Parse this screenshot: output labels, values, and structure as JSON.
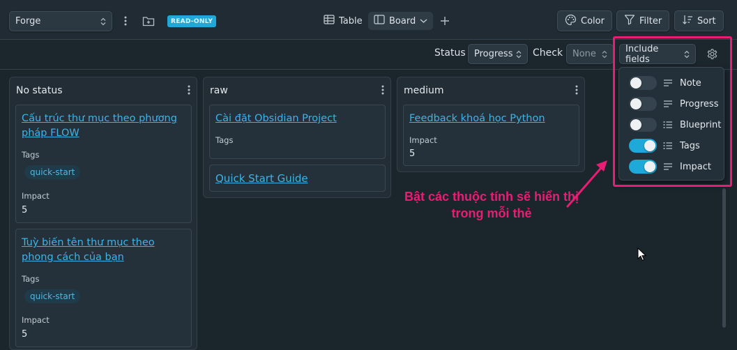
{
  "project": {
    "selected": "Forge",
    "readonly_badge": "READ-ONLY"
  },
  "views": {
    "table_label": "Table",
    "board_label": "Board"
  },
  "toolbar": {
    "color_label": "Color",
    "filter_label": "Filter",
    "sort_label": "Sort"
  },
  "subbar": {
    "status_label": "Status",
    "status_value": "Progress",
    "check_label": "Check",
    "check_value": "None",
    "include_fields_label": "Include fields"
  },
  "columns": [
    {
      "title": "No status",
      "cards": [
        {
          "title": "Cấu trúc thư mục theo phương pháp FLOW",
          "tags_label": "Tags",
          "tag": "quick-start",
          "impact_label": "Impact",
          "impact_value": "5"
        },
        {
          "title": "Tuỳ biến tên thư mục theo phong cách của bạn",
          "tags_label": "Tags",
          "tag": "quick-start",
          "impact_label": "Impact",
          "impact_value": "5"
        }
      ]
    },
    {
      "title": "raw",
      "cards": [
        {
          "title": "Cài đặt Obsidian Project",
          "tags_label": "Tags"
        },
        {
          "title": "Quick Start Guide"
        }
      ]
    },
    {
      "title": "medium",
      "cards": [
        {
          "title": "Feedback khoá học Python",
          "impact_label": "Impact",
          "impact_value": "5"
        }
      ]
    }
  ],
  "fields_popover": {
    "items": [
      {
        "label": "Note",
        "enabled": false,
        "icon": "text-lines-icon"
      },
      {
        "label": "Progress",
        "enabled": false,
        "icon": "text-lines-icon"
      },
      {
        "label": "Blueprint",
        "enabled": false,
        "icon": "list-icon"
      },
      {
        "label": "Tags",
        "enabled": true,
        "icon": "list-icon"
      },
      {
        "label": "Impact",
        "enabled": true,
        "icon": "text-lines-icon"
      }
    ]
  },
  "annotation": {
    "text": "Bật các thuộc tính sẽ hiển thị trong mỗi thẻ"
  },
  "colors": {
    "accent": "#1fa9d8",
    "link": "#3fb3e6",
    "annotation": "#ea1d74",
    "background": "#202b33"
  }
}
